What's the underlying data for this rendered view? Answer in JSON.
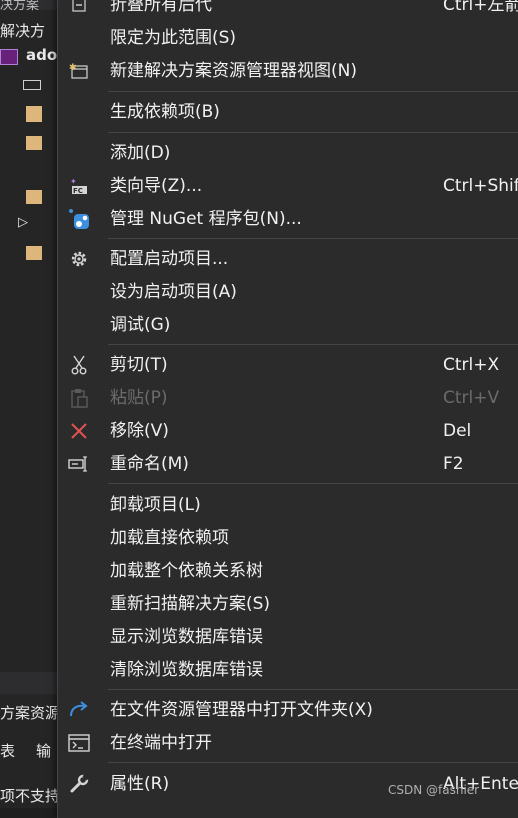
{
  "explorer": {
    "title_frag": "决方案",
    "solution_frag": "解决方",
    "project_frag": "ado",
    "panel_frag": "方案资源",
    "tab1": "表",
    "tab2": "输",
    "status_frag": "项不支持"
  },
  "menu": {
    "items": [
      {
        "label": "折叠所有后代",
        "shortcut": "Ctrl+左箭",
        "icon": "collapse-icon"
      },
      {
        "label": "限定为此范围(S)",
        "shortcut": "",
        "icon": ""
      },
      {
        "label": "新建解决方案资源管理器视图(N)",
        "shortcut": "",
        "icon": "new-view-icon"
      },
      {
        "label": "生成依赖项(B)",
        "shortcut": "",
        "icon": ""
      },
      {
        "label": "添加(D)",
        "shortcut": "",
        "icon": ""
      },
      {
        "label": "类向导(Z)...",
        "shortcut": "Ctrl+Shif",
        "icon": "class-wizard-icon"
      },
      {
        "label": "管理 NuGet 程序包(N)...",
        "shortcut": "",
        "icon": "nuget-icon"
      },
      {
        "label": "配置启动项目...",
        "shortcut": "",
        "icon": "gear-icon"
      },
      {
        "label": "设为启动项目(A)",
        "shortcut": "",
        "icon": ""
      },
      {
        "label": "调试(G)",
        "shortcut": "",
        "icon": ""
      },
      {
        "label": "剪切(T)",
        "shortcut": "Ctrl+X",
        "icon": "scissors-icon"
      },
      {
        "label": "粘贴(P)",
        "shortcut": "Ctrl+V",
        "icon": "paste-icon",
        "disabled": true
      },
      {
        "label": "移除(V)",
        "shortcut": "Del",
        "icon": "remove-icon"
      },
      {
        "label": "重命名(M)",
        "shortcut": "F2",
        "icon": "rename-icon"
      },
      {
        "label": "卸载项目(L)",
        "shortcut": "",
        "icon": ""
      },
      {
        "label": "加载直接依赖项",
        "shortcut": "",
        "icon": ""
      },
      {
        "label": "加载整个依赖关系树",
        "shortcut": "",
        "icon": ""
      },
      {
        "label": "重新扫描解决方案(S)",
        "shortcut": "",
        "icon": ""
      },
      {
        "label": "显示浏览数据库错误",
        "shortcut": "",
        "icon": ""
      },
      {
        "label": "清除浏览数据库错误",
        "shortcut": "",
        "icon": ""
      },
      {
        "label": "在文件资源管理器中打开文件夹(X)",
        "shortcut": "",
        "icon": "open-folder-arrow-icon"
      },
      {
        "label": "在终端中打开",
        "shortcut": "",
        "icon": "terminal-icon"
      },
      {
        "label": "属性(R)",
        "shortcut": "Alt+Ente",
        "icon": "wrench-icon"
      }
    ]
  },
  "watermark": "CSDN @fashier"
}
